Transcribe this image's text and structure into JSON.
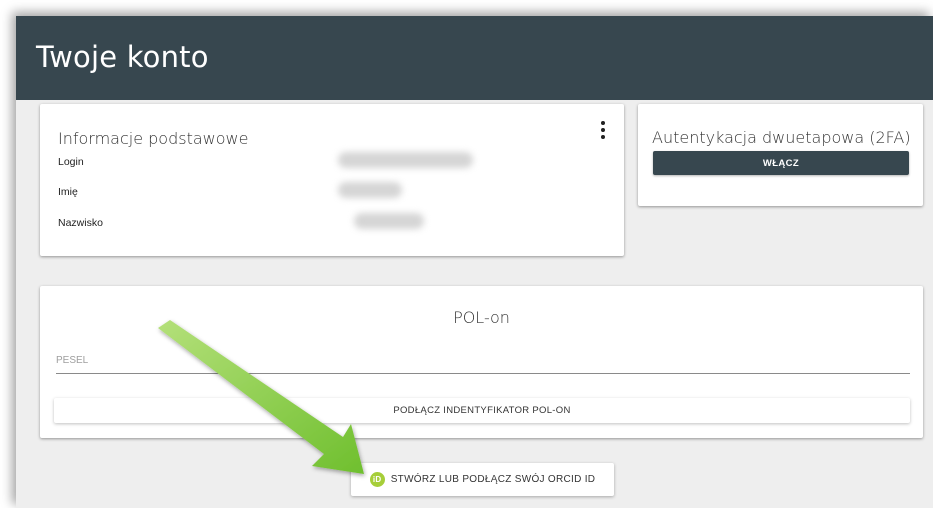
{
  "header": {
    "title": "Twoje konto"
  },
  "basic_info": {
    "title": "Informacje podstawowe",
    "menu_icon": "more-vert-icon",
    "rows": [
      {
        "label": "Login",
        "value_blurred": true
      },
      {
        "label": "Imię",
        "value_blurred": true
      },
      {
        "label": "Nazwisko",
        "value_blurred": true
      }
    ]
  },
  "two_factor": {
    "title": "Autentykacja dwuetapowa (2FA)",
    "enable_label": "WŁĄCZ"
  },
  "polon": {
    "title": "POL-on",
    "pesel_placeholder": "PESEL",
    "pesel_value": "",
    "connect_label": "PODŁĄCZ INDENTYFIKATOR POL-ON"
  },
  "orcid": {
    "icon_text": "iD",
    "label": "STWÓRZ LUB PODŁĄCZ SWÓJ ORCID ID"
  },
  "colors": {
    "header_bg": "#37474f",
    "page_bg": "#eeeeee",
    "button_dark": "#37474f",
    "orcid_green": "#a6ce39",
    "arrow_green": "#7cc243"
  }
}
